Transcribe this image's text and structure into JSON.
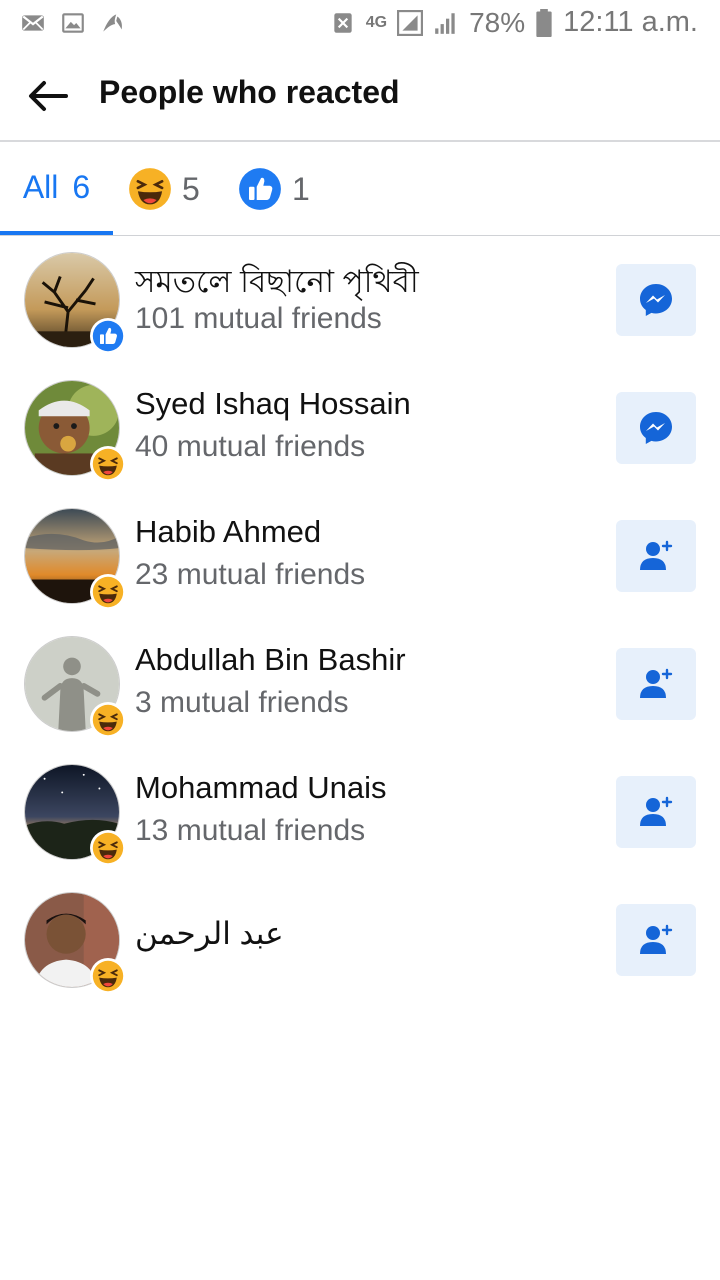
{
  "status_bar": {
    "network": "4G",
    "battery": "78%",
    "time": "12:11 a.m."
  },
  "header": {
    "title": "People who reacted"
  },
  "tabs": [
    {
      "label": "All",
      "count": "6"
    },
    {
      "icon": "haha-reaction-icon",
      "count": "5"
    },
    {
      "icon": "like-reaction-icon",
      "count": "1"
    }
  ],
  "people": [
    {
      "name": "সমতলে বিছানো পৃথিবী",
      "mutual": "101 mutual friends",
      "reaction": "like",
      "action": "message"
    },
    {
      "name": "Syed Ishaq Hossain",
      "mutual": "40 mutual friends",
      "reaction": "haha",
      "action": "message"
    },
    {
      "name": "Habib Ahmed",
      "mutual": "23 mutual friends",
      "reaction": "haha",
      "action": "add-friend"
    },
    {
      "name": "Abdullah Bin Bashir",
      "mutual": "3 mutual friends",
      "reaction": "haha",
      "action": "add-friend"
    },
    {
      "name": "Mohammad Unais",
      "mutual": "13 mutual friends",
      "reaction": "haha",
      "action": "add-friend"
    },
    {
      "name": "عبد الرحمن",
      "mutual": "",
      "reaction": "haha",
      "action": "add-friend"
    }
  ],
  "colors": {
    "accent": "#1877f2",
    "button_bg": "#e7f0fb",
    "secondary_text": "#65676b"
  }
}
